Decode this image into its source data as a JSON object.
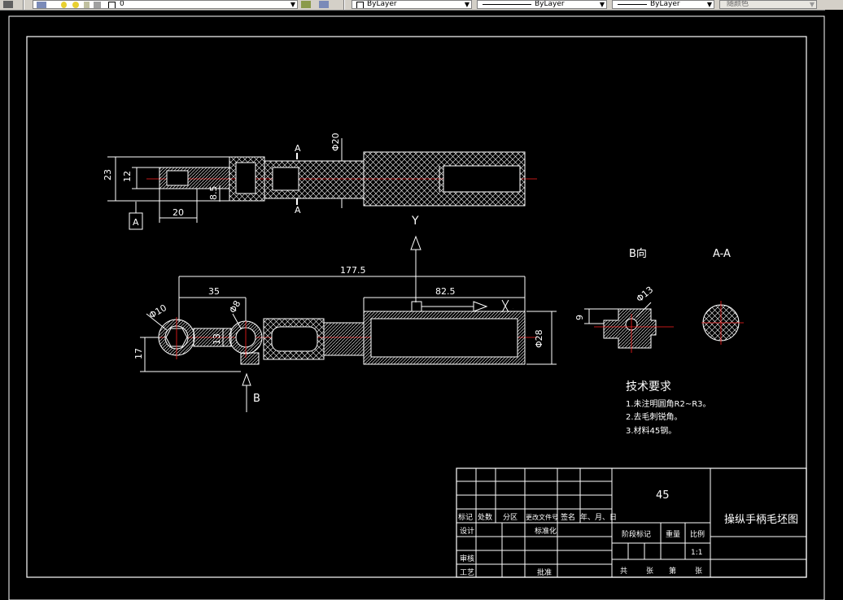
{
  "toolbar": {
    "layer_value": "0",
    "color_value": "ByLayer",
    "linetype_value": "ByLayer",
    "lineweight_value": "ByLayer",
    "plotstyle_value": "随颜色"
  },
  "drawing": {
    "top_view": {
      "dims": {
        "d23": "23",
        "d12": "12",
        "d20": "20",
        "d8_5": "8.5",
        "phi20": "Φ20"
      },
      "section_label_a_top": "A",
      "section_label_a_bottom": "A",
      "view_marker_a": "A",
      "view_y": "Y"
    },
    "front_view": {
      "dims": {
        "d177_5": "177.5",
        "d35": "35",
        "d82_5": "82.5",
        "phi10": "Φ10",
        "phi8": "Φ8",
        "d13": "13",
        "d17": "17",
        "phi28": "Φ28"
      },
      "view_x": "X",
      "arrow_b_label": "B"
    },
    "b_view": {
      "title": "B向",
      "dim_9": "9",
      "phi13": "Φ13"
    },
    "aa_view": {
      "title": "A-A"
    },
    "tech_requirements": {
      "title": "技术要求",
      "items": [
        "1.未注明圆角R2~R3。",
        "2.去毛刺锐角。",
        "3.材料45钢。"
      ]
    },
    "title_block": {
      "material": "45",
      "drawing_name": "操纵手柄毛坯图",
      "labels": {
        "mark": "标记",
        "count": "处数",
        "zone": "分区",
        "change_doc": "更改文件号",
        "sign": "签名",
        "date": "年、月、日",
        "design": "设计",
        "standard": "标准化",
        "check": "审核",
        "process": "工艺",
        "approve": "批准",
        "stage_mark": "阶段标记",
        "weight": "重量",
        "scale": "比例",
        "scale_value": "1:1",
        "total": "共",
        "sheet1": "张",
        "page": "第",
        "sheet2": "张"
      }
    }
  }
}
